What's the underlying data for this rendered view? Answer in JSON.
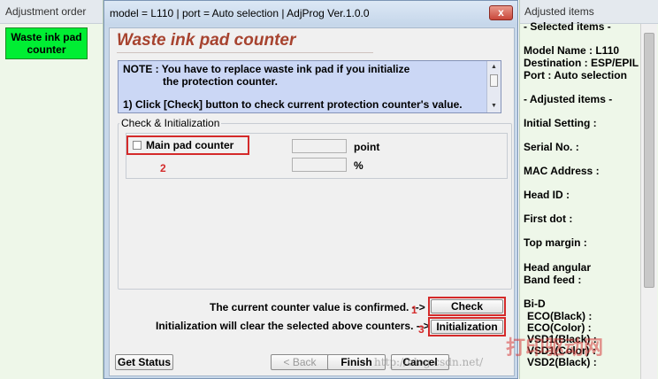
{
  "left_panel": {
    "header": "Adjustment order",
    "item": "Waste ink pad counter"
  },
  "dialog": {
    "title": "model = L110 | port = Auto selection | AdjProg Ver.1.0.0",
    "close_label": "x",
    "heading": "Waste ink pad counter",
    "note_line1": "NOTE : You have to replace waste ink pad if you initialize",
    "note_line2": "the protection counter.",
    "note_line3": "1) Click [Check] button to check current protection counter's value.",
    "group_label": "Check & Initialization",
    "main_pad_label": "Main pad counter",
    "unit_point": "point",
    "unit_percent": "%",
    "point_value": "",
    "percent_value": "",
    "marker_2": "2",
    "marker_1": "1",
    "marker_3": "3",
    "confirm_msg": "The current counter value is confirmed. -->",
    "init_msg": "Initialization will clear the selected above counters. -->",
    "check_label": "Check",
    "init_label": "Initialization",
    "get_status_label": "Get Status",
    "back_label": "< Back",
    "finish_label": "Finish",
    "cancel_label": "Cancel"
  },
  "right_panel": {
    "header": "Adjusted items",
    "selected_items": "- Selected items -",
    "model": "Model Name : L110",
    "destination": "Destination : ESP/EPIL",
    "port": "Port : Auto selection",
    "adjusted_items": "- Adjusted items -",
    "initial_setting": "Initial Setting :",
    "serial": "Serial No. :",
    "mac": "MAC Address :",
    "head_id": "Head ID :",
    "first_dot": "First dot :",
    "top_margin": "Top margin :",
    "head_angular": "Head angular",
    "band_feed": "Band feed :",
    "bid": "Bi-D",
    "eco_black": "ECO(Black)  :",
    "eco_color": "ECO(Color)  :",
    "vsd1_black": "VSD1(Black) :",
    "vsd1_color": "VSD1(Color) :",
    "vsd2_black": "VSD2(Black) :"
  },
  "watermarks": {
    "logo_text": "打印驱动网",
    "url_text": "http://blog.csdn.net/"
  },
  "colors": {
    "accent_green": "#00ee33",
    "heading_red": "#a7432f",
    "annotation_red": "#d42a2a",
    "note_blue": "#cbd7f5"
  }
}
